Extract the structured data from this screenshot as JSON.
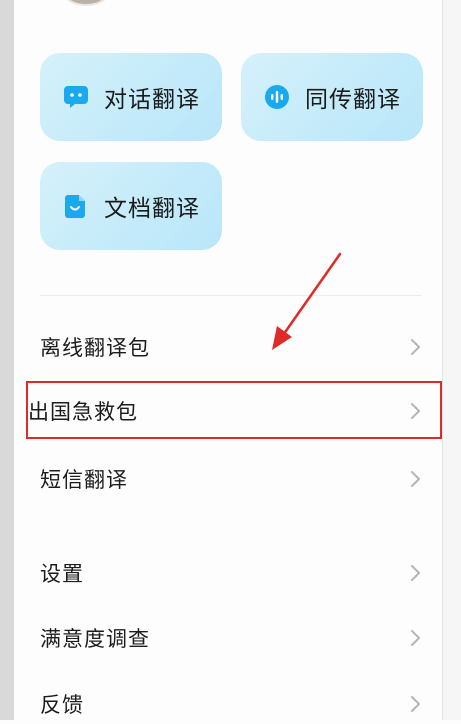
{
  "colors": {
    "accent_icon": "#1aa9ee",
    "card_bg": "#c8ecfa",
    "annotation_red": "#e02a2a"
  },
  "feature_cards": [
    {
      "label": "对话翻译",
      "icon": "chat-bubble-icon"
    },
    {
      "label": "同传翻译",
      "icon": "voice-wave-icon"
    },
    {
      "label": "文档翻译",
      "icon": "document-icon"
    }
  ],
  "menu": {
    "group1": [
      {
        "label": "离线翻译包"
      },
      {
        "label": "出国急救包"
      },
      {
        "label": "短信翻译"
      }
    ],
    "group2": [
      {
        "label": "设置"
      },
      {
        "label": "满意度调查"
      },
      {
        "label": "反馈"
      }
    ]
  },
  "annotation": {
    "highlighted_item": "出国急救包",
    "arrow_icon": "red-arrow-icon"
  }
}
